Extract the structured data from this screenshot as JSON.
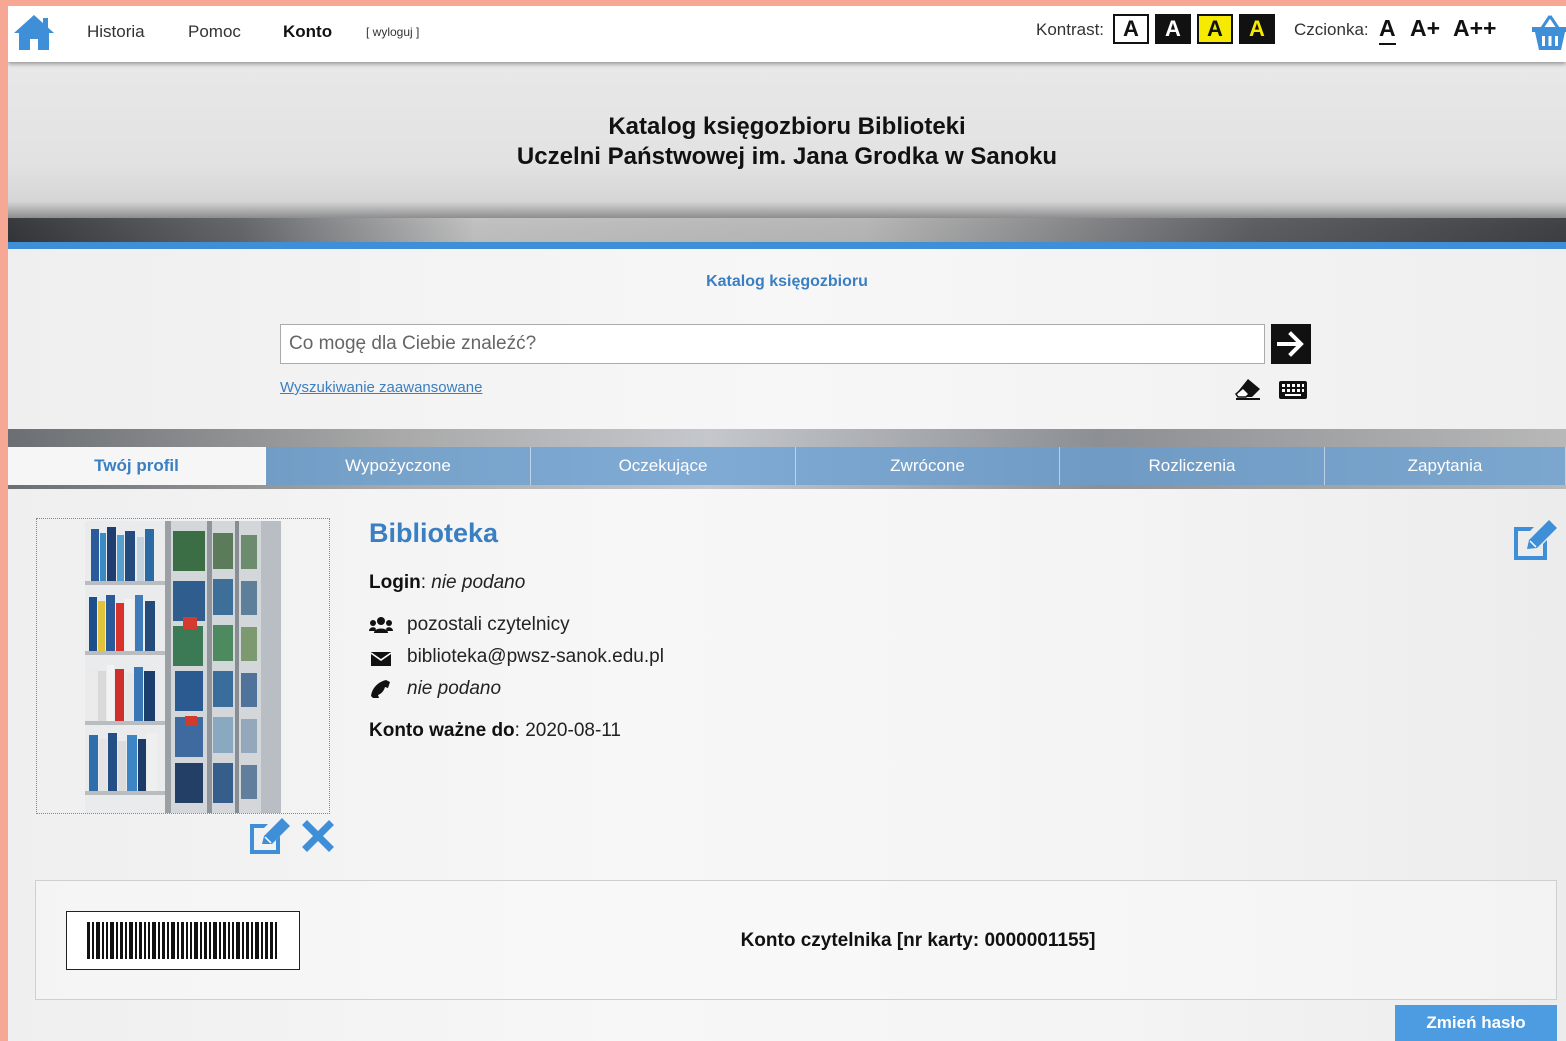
{
  "nav": {
    "history": "Historia",
    "help": "Pomoc",
    "account": "Konto",
    "logout": "[ wyloguj ]",
    "contrast_label": "Kontrast:",
    "contrast_options": [
      "A",
      "A",
      "A",
      "A"
    ],
    "font_label": "Czcionka:",
    "font_sizes": [
      "A",
      "A+",
      "A++"
    ]
  },
  "banner": {
    "title_line1": "Katalog księgozbioru Biblioteki",
    "title_line2": "Uczelni Państwowej im. Jana Grodka w Sanoku"
  },
  "search": {
    "section_title": "Katalog księgozbioru",
    "placeholder": "Co mogę dla Ciebie znaleźć?",
    "advanced_link": "Wyszukiwanie zaawansowane"
  },
  "tabs": [
    "Twój profil",
    "Wypożyczone",
    "Oczekujące",
    "Zwrócone",
    "Rozliczenia",
    "Zapytania"
  ],
  "profile": {
    "name": "Biblioteka",
    "login_label": "Login",
    "login_value": "nie podano",
    "group": "pozostali czytelnicy",
    "email": "biblioteka@pwsz-sanok.edu.pl",
    "phone": "nie podano",
    "valid_label": "Konto ważne do",
    "valid_value": "2020-08-11"
  },
  "card": {
    "text": "Konto czytelnika [nr karty: 0000001155]"
  },
  "actions": {
    "change_password": "Zmień hasło"
  },
  "colors": {
    "accent": "#3a7fc1",
    "rule_blue": "#3e8fd8",
    "button_blue": "#4d9be0",
    "page_border": "#f6a894"
  }
}
